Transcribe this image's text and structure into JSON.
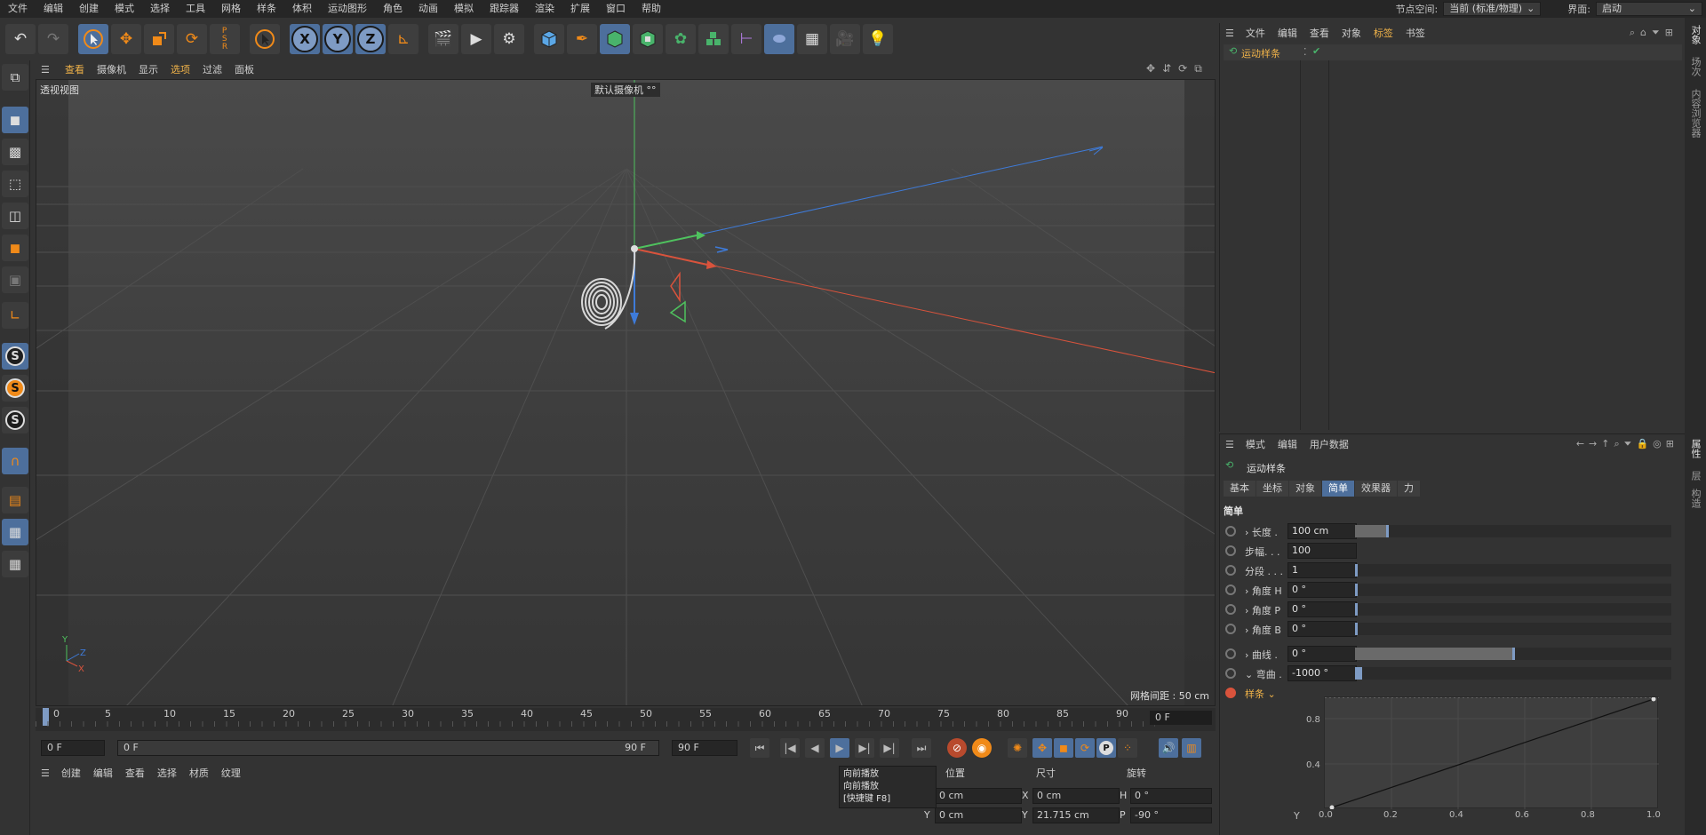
{
  "menubar": {
    "items": [
      "文件",
      "编辑",
      "创建",
      "模式",
      "选择",
      "工具",
      "网格",
      "样条",
      "体积",
      "运动图形",
      "角色",
      "动画",
      "模拟",
      "跟踪器",
      "渲染",
      "扩展",
      "窗口",
      "帮助"
    ],
    "node_space_label": "节点空间:",
    "node_space_value": "当前 (标准/物理)",
    "layout_label": "界面:",
    "layout_value": "启动"
  },
  "viewport": {
    "menu": [
      "查看",
      "摄像机",
      "显示",
      "选项",
      "过滤",
      "面板"
    ],
    "active_menu": "选项",
    "label": "透视视图",
    "camera": "默认摄像机 °°",
    "grid_spacing": "网格间距 : 50 cm",
    "axis_x_color": "#d9533c",
    "axis_y_color": "#4fc25e",
    "axis_z_color": "#3e7bd9"
  },
  "timeline": {
    "ticks": [
      "0",
      "5",
      "10",
      "15",
      "20",
      "25",
      "30",
      "35",
      "40",
      "45",
      "50",
      "55",
      "60",
      "65",
      "70",
      "75",
      "80",
      "85",
      "90"
    ],
    "current_frame": "0 F",
    "start_field": "0 F",
    "range_start": "0 F",
    "range_end": "90 F",
    "end_field": "90 F"
  },
  "material": {
    "menu": [
      "创建",
      "编辑",
      "查看",
      "选择",
      "材质",
      "纹理"
    ]
  },
  "tooltip": {
    "title": "向前播放",
    "desc": "向前播放",
    "shortcut": "[快捷键 F8]"
  },
  "coords": {
    "headers": [
      "位置",
      "尺寸",
      "旋转"
    ],
    "rows": [
      {
        "axis": "X",
        "pos": "0 cm",
        "size_axis": "X",
        "size": "0 cm",
        "rot_axis": "H",
        "rot": "0 °"
      },
      {
        "axis": "Y",
        "pos": "0 cm",
        "size_axis": "Y",
        "size": "21.715 cm",
        "rot_axis": "P",
        "rot": "-90 °"
      }
    ]
  },
  "object_manager": {
    "menu": [
      "文件",
      "编辑",
      "查看",
      "对象",
      "标签",
      "书签"
    ],
    "active_menu": "标签",
    "object_name": "运动样条"
  },
  "side_tabs": [
    "对象",
    "场次",
    "内容浏览器",
    "属性",
    "层",
    "构造"
  ],
  "attributes": {
    "menu": [
      "模式",
      "编辑",
      "用户数据"
    ],
    "object_title": "运动样条",
    "tabs": [
      "基本",
      "坐标",
      "对象",
      "简单",
      "效果器",
      "力"
    ],
    "active_tab": "简单",
    "section": "简单",
    "params": [
      {
        "label": "› 长度 .",
        "value": "100 cm",
        "fill": 0.1
      },
      {
        "label": "步幅. . .",
        "value": "100",
        "fill": null
      },
      {
        "label": "分段 . . .",
        "value": "1",
        "fill": 0.0
      },
      {
        "label": "› 角度 H",
        "value": "0 °",
        "fill": 0.0
      },
      {
        "label": "› 角度 P",
        "value": "0 °",
        "fill": 0.0
      },
      {
        "label": "› 角度 B",
        "value": "0 °",
        "fill": 0.0
      },
      {
        "label": "› 曲线 .",
        "value": "0 °",
        "fill": 0.5
      },
      {
        "label": "⌄ 弯曲 .",
        "value": "-1000 °",
        "fill": 0.02
      }
    ],
    "spline_label": "样条",
    "graph_y_labels": [
      "0.8",
      "0.4"
    ],
    "graph_x_labels": [
      "0.0",
      "0.2",
      "0.4",
      "0.6",
      "0.8",
      "1.0"
    ],
    "graph_axis_y": "Y"
  }
}
